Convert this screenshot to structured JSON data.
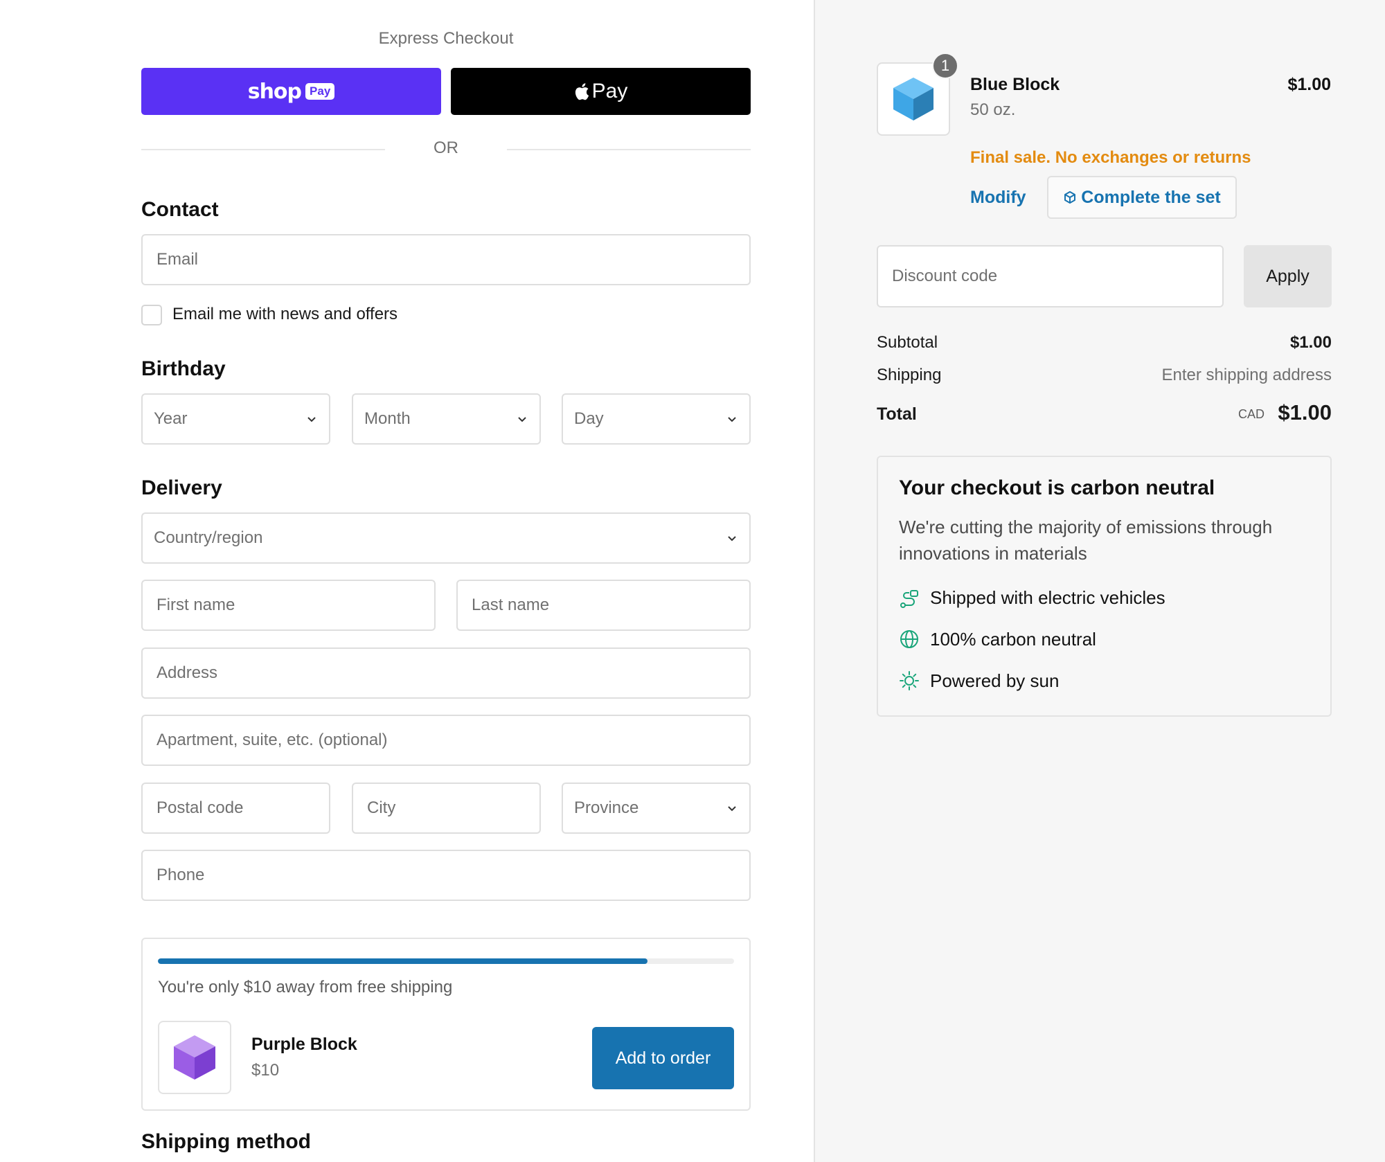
{
  "express": {
    "title": "Express Checkout",
    "shop_pay_word": "shop",
    "shop_pay_pill": "Pay",
    "apple_pay_label": "Pay",
    "or_label": "OR"
  },
  "contact": {
    "title": "Contact",
    "email_placeholder": "Email",
    "newsletter_label": "Email me with news and offers"
  },
  "birthday": {
    "title": "Birthday",
    "year": "Year",
    "month": "Month",
    "day": "Day"
  },
  "delivery": {
    "title": "Delivery",
    "country": "Country/region",
    "first_name": "First name",
    "last_name": "Last name",
    "address": "Address",
    "apartment": "Apartment, suite, etc. (optional)",
    "postal": "Postal code",
    "city": "City",
    "province": "Province",
    "phone": "Phone"
  },
  "upsell": {
    "progress_fraction": 0.85,
    "message": "You're only $10 away from free shipping",
    "product_name": "Purple Block",
    "product_price": "$10",
    "add_label": "Add to order"
  },
  "shipping_method": {
    "title": "Shipping method"
  },
  "cart": {
    "quantity": "1",
    "product_name": "Blue Block",
    "variant": "50 oz.",
    "price": "$1.00",
    "final_sale": "Final sale. No exchanges or returns",
    "modify_label": "Modify",
    "complete_set_label": "Complete the set"
  },
  "discount": {
    "placeholder": "Discount code",
    "apply_label": "Apply"
  },
  "summary": {
    "subtotal_label": "Subtotal",
    "subtotal_value": "$1.00",
    "shipping_label": "Shipping",
    "shipping_value": "Enter shipping address",
    "total_label": "Total",
    "total_currency": "CAD",
    "total_value": "$1.00"
  },
  "carbon": {
    "title": "Your checkout is carbon neutral",
    "description": "We're cutting the majority of emissions through innovations in materials",
    "perks": [
      {
        "icon": "electric-vehicle-icon",
        "label": "Shipped with electric vehicles"
      },
      {
        "icon": "globe-icon",
        "label": "100% carbon neutral"
      },
      {
        "icon": "sun-icon",
        "label": "Powered by sun"
      }
    ]
  },
  "colors": {
    "shop_pay": "#5a31f4",
    "accent_blue": "#1773b0",
    "warning_orange": "#e38b10",
    "eco_green": "#1aa57a",
    "blue_block": "#3ea6e6",
    "purple_block": "#9b5de5"
  }
}
